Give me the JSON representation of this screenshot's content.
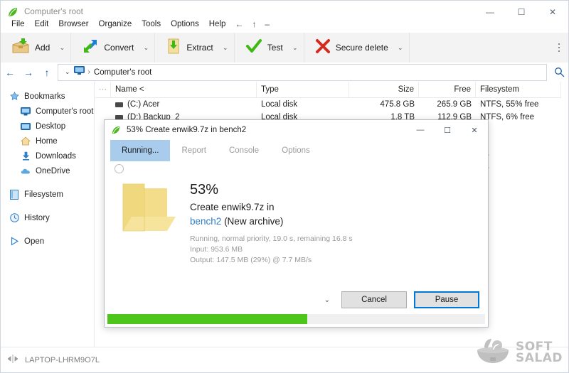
{
  "window": {
    "title": "Computer's root",
    "app_icon": "peazip-leaf-icon",
    "controls": [
      {
        "name": "minimize",
        "glyph": "—"
      },
      {
        "name": "maximize",
        "glyph": "☐"
      },
      {
        "name": "close",
        "glyph": "✕"
      }
    ]
  },
  "menubar": {
    "items": [
      "File",
      "Edit",
      "Browser",
      "Organize",
      "Tools",
      "Options",
      "Help"
    ],
    "nav": [
      {
        "name": "back",
        "glyph": "←"
      },
      {
        "name": "up",
        "glyph": "↑"
      },
      {
        "name": "minimize-pane",
        "glyph": "–"
      }
    ]
  },
  "toolbar": {
    "buttons": [
      {
        "label": "Add",
        "icon": "add-archive-icon",
        "caret": "⌄"
      },
      {
        "label": "Convert",
        "icon": "convert-icon",
        "caret": "⌄"
      },
      {
        "label": "Extract",
        "icon": "extract-icon",
        "caret": "⌄"
      },
      {
        "label": "Test",
        "icon": "test-check-icon",
        "caret": "⌄"
      },
      {
        "label": "Secure delete",
        "icon": "secure-delete-icon",
        "caret": "⌄"
      }
    ],
    "overflow": "more-options-icon"
  },
  "addressbar": {
    "back": "←",
    "forward": "→",
    "up": "↑",
    "dropdown_caret": "⌄",
    "computer_icon": "computer-monitor-icon",
    "separator": "›",
    "path": "Computer's root",
    "search_icon": "search-icon"
  },
  "sidebar": {
    "groups": [
      {
        "items": [
          {
            "label": "Bookmarks",
            "icon": "star-icon",
            "child": false
          },
          {
            "label": "Computer's root",
            "icon": "computer-monitor-icon",
            "child": true
          },
          {
            "label": "Desktop",
            "icon": "desktop-icon",
            "child": true
          },
          {
            "label": "Home",
            "icon": "home-icon",
            "child": true
          },
          {
            "label": "Downloads",
            "icon": "download-icon",
            "child": true
          },
          {
            "label": "OneDrive",
            "icon": "cloud-icon",
            "child": true
          }
        ]
      },
      {
        "items": [
          {
            "label": "Filesystem",
            "icon": "filesystem-icon",
            "child": false
          }
        ]
      },
      {
        "items": [
          {
            "label": "History",
            "icon": "clock-icon",
            "child": false
          }
        ]
      },
      {
        "items": [
          {
            "label": "Open",
            "icon": "play-triangle-icon",
            "child": false
          }
        ]
      }
    ]
  },
  "filelist": {
    "columns": [
      "···",
      "Name <",
      "Type",
      "Size",
      "Free",
      "Filesystem"
    ],
    "rows": [
      {
        "name": "(C:) Acer",
        "type": "Local disk",
        "size": "475.8 GB",
        "free": "265.9 GB",
        "filesystem": "NTFS, 55% free"
      },
      {
        "name": "(D:) Backup_2",
        "type": "Local disk",
        "size": "1.8 TB",
        "free": "112.9 GB",
        "filesystem": "NTFS, 6% free"
      },
      {
        "name": "",
        "type": "",
        "size": "",
        "free": "",
        "filesystem": "e"
      },
      {
        "name": "",
        "type": "",
        "size": "",
        "free": "",
        "filesystem": "e"
      },
      {
        "name": "",
        "type": "",
        "size": "",
        "free": "",
        "filesystem": "ee"
      },
      {
        "name": "",
        "type": "",
        "size": "",
        "free": "",
        "filesystem": "ee"
      }
    ]
  },
  "statusbar": {
    "icon": "resize-handle-icon",
    "text": "LAPTOP-LHRM9O7L"
  },
  "dialog": {
    "icon": "peazip-leaf-icon",
    "title": "53% Create enwik9.7z in bench2",
    "controls": [
      {
        "name": "minimize",
        "glyph": "—"
      },
      {
        "name": "maximize",
        "glyph": "☐"
      },
      {
        "name": "close",
        "glyph": "✕"
      }
    ],
    "tabs": [
      {
        "label": "Running...",
        "active": true
      },
      {
        "label": "Report",
        "active": false
      },
      {
        "label": "Console",
        "active": false
      },
      {
        "label": "Options",
        "active": false
      }
    ],
    "spinner": "progress-spinner-icon",
    "folder_icon": "folder-icon",
    "percent": "53%",
    "task_line": "Create enwik9.7z in",
    "target_link": "bench2",
    "target_suffix": "(New archive)",
    "status_lines": [
      "Running, normal priority, 19.0 s, remaining 16.8 s",
      "Input: 953.6 MB",
      "Output: 147.5 MB (29%) @ 7.7 MB/s"
    ],
    "footer_caret": "⌄",
    "cancel_label": "Cancel",
    "pause_label": "Pause",
    "progress_percent": 53,
    "progress_color": "#4ec51a"
  },
  "watermark": {
    "line1": "SOFT",
    "line2": "SALAD",
    "icon": "salad-bowl-icon"
  },
  "colors": {
    "accent": "#0078d7",
    "tab_active_bg": "#a9cced",
    "link": "#2f7fc9",
    "progress_green": "#4ec51a"
  }
}
